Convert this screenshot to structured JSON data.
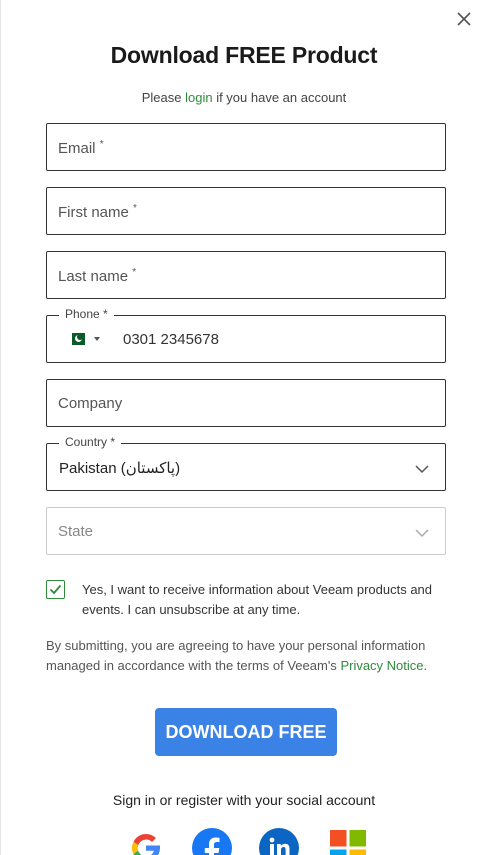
{
  "title": "Download FREE Product",
  "login_line": {
    "prefix": "Please",
    "link": "login",
    "suffix": "if you have an account"
  },
  "fields": {
    "email": "Email",
    "first_name": "First name",
    "last_name": "Last name",
    "phone_label": "Phone *",
    "phone_value": "0301 2345678",
    "company": "Company",
    "country_label": "Country *",
    "country_value": "Pakistan (پاکستان)",
    "state": "State",
    "required_mark": "*"
  },
  "consent": "Yes, I want to receive information about Veeam products and events. I can unsubscribe at any time.",
  "terms": {
    "text": "By submitting, you are agreeing to have your personal information managed in accordance with the terms of Veeam's",
    "link": "Privacy Notice",
    "end": "."
  },
  "download_button": "DOWNLOAD FREE",
  "social_line": "Sign in or register with your social account",
  "colors": {
    "accent_green": "#2e8b3a",
    "button_blue": "#3b82e6"
  },
  "icons": [
    "close-icon",
    "pakistan-flag-icon",
    "chevron-down-icon",
    "checkmark-icon",
    "google-icon",
    "facebook-icon",
    "linkedin-icon",
    "microsoft-icon"
  ]
}
